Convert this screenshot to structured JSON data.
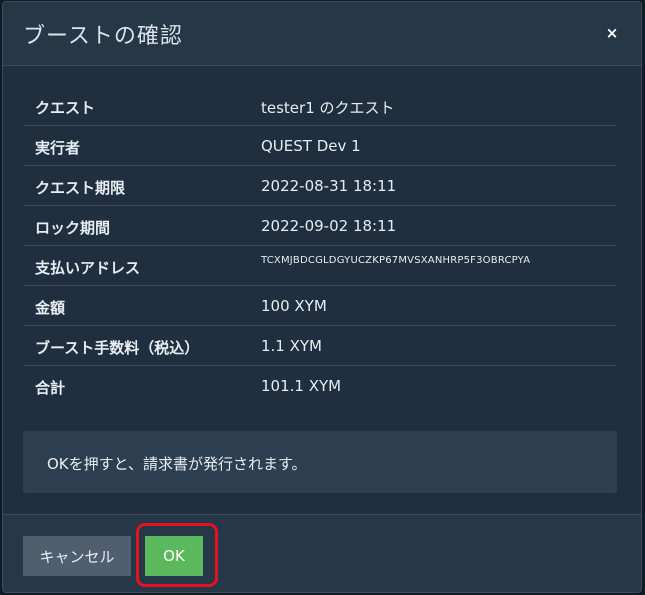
{
  "dialog": {
    "title": "ブーストの確認",
    "close_label": "×",
    "rows": [
      {
        "label": "クエスト",
        "value": "tester1 のクエスト"
      },
      {
        "label": "実行者",
        "value": "QUEST Dev 1"
      },
      {
        "label": "クエスト期限",
        "value": "2022-08-31 18:11"
      },
      {
        "label": "ロック期間",
        "value": "2022-09-02 18:11"
      },
      {
        "label": "支払いアドレス",
        "value": "TCXMJBDCGLDGYUCZKP67MVSXANHRP5F3OBRCPYA"
      },
      {
        "label": "金額",
        "value": "100 XYM"
      },
      {
        "label": "ブースト手数料（税込）",
        "value": "1.1 XYM"
      },
      {
        "label": "合計",
        "value": "101.1 XYM"
      }
    ],
    "notice": "OKを押すと、請求書が発行されます。",
    "cancel_label": "キャンセル",
    "ok_label": "OK"
  },
  "colors": {
    "ok_button": "#5cb85c",
    "cancel_button": "#4f5f6f",
    "highlight": "#e3131f",
    "panel": "#1f2f3f"
  }
}
